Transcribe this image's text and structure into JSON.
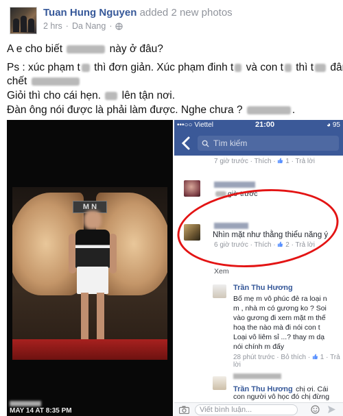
{
  "post": {
    "author": "Tuan Hung Nguyen",
    "action": "added 2 new photos",
    "time": "2 hrs",
    "location": "Da Nang",
    "separator": "·",
    "lines": [
      {
        "a": "A e cho biết",
        "b": "này ở đâu?"
      },
      {
        "a": "Ps : xúc phạm t",
        "b": "thì đơn giản. Xúc phạm đinh t",
        "c": "và con t",
        "d": "thì t",
        "e": "đâm"
      },
      {
        "a": "chết",
        "b": ""
      },
      {
        "a": "Giỏi thì cho cái hẹn.",
        "b": "lên tận nơi."
      },
      {
        "a": "Đàn ông nói được là phải làm được. Nghe chưa ?",
        "b": "."
      }
    ]
  },
  "photo_left": {
    "sign_text": "M N",
    "date": "MAY 14 AT 8:35 PM"
  },
  "phone": {
    "carrier": "•••○○ Viettel",
    "time": "21:00",
    "battery": "◕ 95",
    "search_placeholder": "Tìm kiếm",
    "top_meta": {
      "time": "7 giờ trước",
      "like": "Thích",
      "count": "1",
      "reply": "Trả lời"
    },
    "comment1_text": "giờ trước",
    "comment2": {
      "text": "Nhìn mặt như thằng thiểu năng ý",
      "time": "6 giờ trước",
      "like": "Thích",
      "count": "2",
      "reply": "Trả lời"
    },
    "comment3_prefix": "Xem",
    "comment4": {
      "name": "Trần Thu Hương",
      "lines": [
        "Bố mẹ m vô phúc đẻ ra loại n",
        "m , nhà m có gương ko ? Soi",
        "vào gương đi xem mặt m thế",
        "hoạ the nào mà đi nói con t",
        "Loại vô liêm sỉ ...? thay m dạ",
        "nói chính m đấy"
      ],
      "time": "28 phút trước",
      "hide": "Bỏ thích",
      "count": "1",
      "reply": "Trả lời"
    },
    "comment5": {
      "name": "Trần Thu Hương",
      "text": "chị ơi. Cái",
      "line2": "con người vô học đó chị đừng"
    },
    "reply_placeholder": "Viết bình luận..."
  },
  "colors": {
    "fb_blue": "#3b5998",
    "link": "#365899",
    "annotation_red": "#e31414"
  }
}
